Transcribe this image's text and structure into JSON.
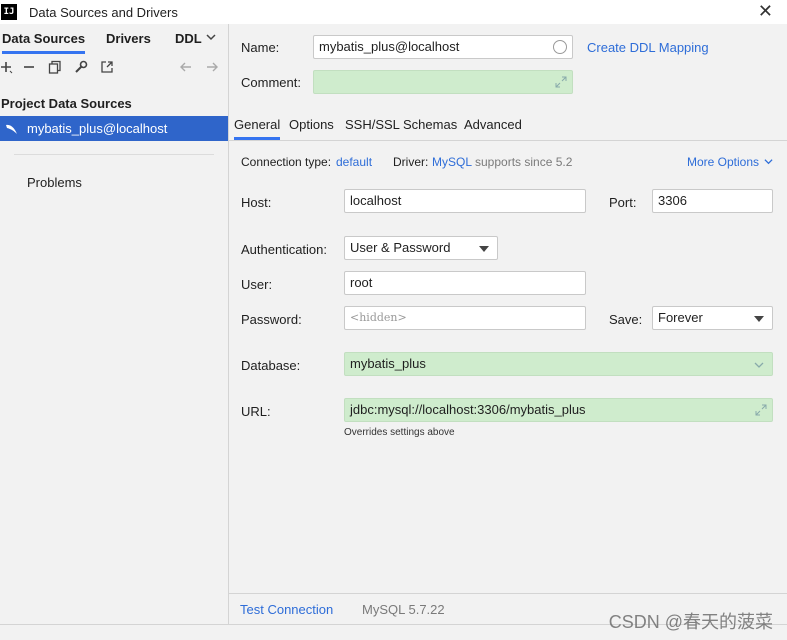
{
  "window": {
    "title": "Data Sources and Drivers",
    "logo": "IJ"
  },
  "left": {
    "tabs": [
      "Data Sources",
      "Drivers",
      "DDL"
    ],
    "section_title": "Project Data Sources",
    "selected_source": "mybatis_plus@localhost",
    "problems": "Problems"
  },
  "form": {
    "name_label": "Name:",
    "name_value": "mybatis_plus@localhost",
    "create_ddl": "Create DDL Mapping",
    "comment_label": "Comment:",
    "tabs": [
      "General",
      "Options",
      "SSH/SSL",
      "Schemas",
      "Advanced"
    ],
    "conn_type_label": "Connection type:",
    "conn_type_value": "default",
    "driver_label": "Driver:",
    "driver_value": "MySQL",
    "driver_note": "supports since 5.2",
    "more_options": "More Options",
    "host_label": "Host:",
    "host_value": "localhost",
    "port_label": "Port:",
    "port_value": "3306",
    "auth_label": "Authentication:",
    "auth_value": "User & Password",
    "user_label": "User:",
    "user_value": "root",
    "password_label": "Password:",
    "password_placeholder": "<hidden>",
    "save_label": "Save:",
    "save_value": "Forever",
    "database_label": "Database:",
    "database_value": "mybatis_plus",
    "url_label": "URL:",
    "url_value": "jdbc:mysql://localhost:3306/mybatis_plus",
    "url_hint": "Overrides settings above"
  },
  "footer": {
    "test_connection": "Test Connection",
    "version": "MySQL 5.7.22"
  },
  "watermark": "CSDN @春天的菠菜",
  "colors": {
    "accent": "#3574f0",
    "selection": "#2f65ca",
    "link": "#2e6dd8",
    "green_field": "#cfeccd"
  }
}
